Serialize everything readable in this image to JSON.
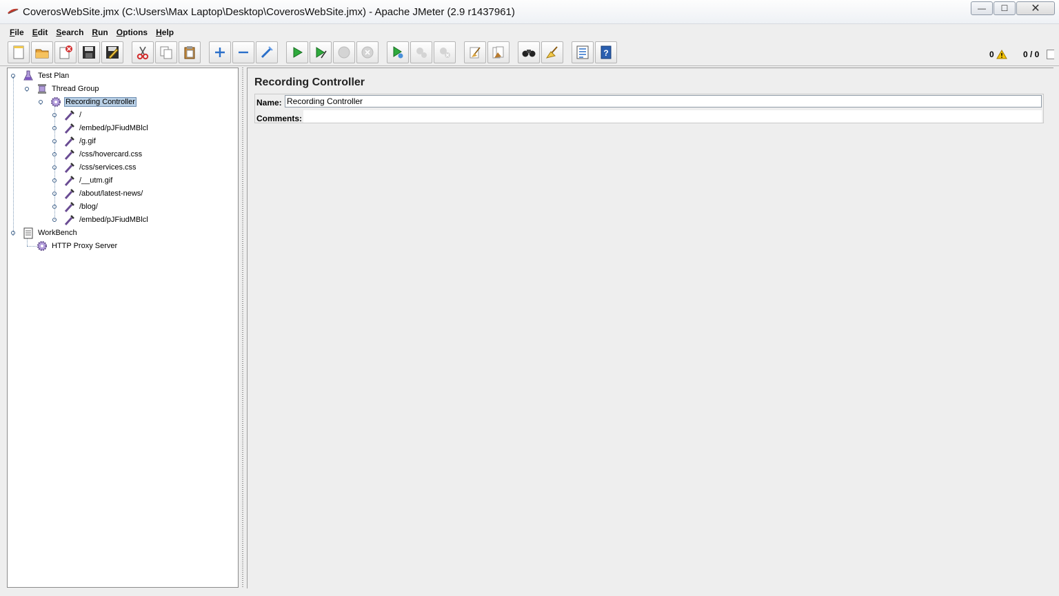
{
  "window": {
    "title": "CoverosWebSite.jmx (C:\\Users\\Max Laptop\\Desktop\\CoverosWebSite.jmx) - Apache JMeter (2.9 r1437961)",
    "controls": {
      "minimize": "—",
      "maximize": "☐",
      "close": "✕"
    }
  },
  "menu": [
    {
      "label": "File",
      "mnemonic": "F",
      "rest": "ile"
    },
    {
      "label": "Edit",
      "mnemonic": "E",
      "rest": "dit"
    },
    {
      "label": "Search",
      "mnemonic": "S",
      "rest": "earch"
    },
    {
      "label": "Run",
      "mnemonic": "R",
      "rest": "un"
    },
    {
      "label": "Options",
      "mnemonic": "O",
      "rest": "ptions"
    },
    {
      "label": "Help",
      "mnemonic": "H",
      "rest": "elp"
    }
  ],
  "toolbar": {
    "buttons": [
      {
        "name": "new-button",
        "icon": "new-document-icon"
      },
      {
        "name": "open-button",
        "icon": "open-folder-icon"
      },
      {
        "name": "close-button",
        "icon": "close-document-icon"
      },
      {
        "name": "save-button",
        "icon": "floppy-save-icon"
      },
      {
        "name": "save-as-button",
        "icon": "save-edit-icon"
      },
      {
        "name": "cut-button",
        "icon": "scissors-icon"
      },
      {
        "name": "copy-button",
        "icon": "copy-icon"
      },
      {
        "name": "paste-button",
        "icon": "clipboard-paste-icon"
      },
      {
        "name": "expand-all-button",
        "icon": "plus-icon"
      },
      {
        "name": "collapse-all-button",
        "icon": "minus-icon"
      },
      {
        "name": "toggle-button",
        "icon": "wand-toggle-icon"
      },
      {
        "name": "start-button",
        "icon": "play-icon"
      },
      {
        "name": "start-no-pauses-button",
        "icon": "play-no-pause-icon"
      },
      {
        "name": "stop-button",
        "icon": "stop-icon"
      },
      {
        "name": "shutdown-button",
        "icon": "shutdown-icon"
      },
      {
        "name": "remote-start-all-button",
        "icon": "remote-play-icon"
      },
      {
        "name": "remote-stop-all-button",
        "icon": "remote-stop-icon"
      },
      {
        "name": "remote-shutdown-all-button",
        "icon": "remote-shutdown-icon"
      },
      {
        "name": "clear-button",
        "icon": "broom-clear-icon"
      },
      {
        "name": "clear-all-button",
        "icon": "broom-clear-all-icon"
      },
      {
        "name": "search-button",
        "icon": "binoculars-icon"
      },
      {
        "name": "reset-search-button",
        "icon": "broom-reset-icon"
      },
      {
        "name": "function-helper-button",
        "icon": "function-list-icon"
      },
      {
        "name": "help-button",
        "icon": "help-book-icon"
      }
    ],
    "error_count": "0",
    "thread_count": "0 / 0"
  },
  "tree": {
    "nodes": [
      {
        "label": "Test Plan",
        "icon": "flask-icon"
      },
      {
        "label": "Thread Group",
        "icon": "spool-icon"
      },
      {
        "label": "Recording Controller",
        "icon": "gear-icon",
        "selected": true
      },
      {
        "label": "/",
        "icon": "pipette-sampler-icon"
      },
      {
        "label": "/embed/pJFiudMBlcl",
        "icon": "pipette-sampler-icon"
      },
      {
        "label": "/g.gif",
        "icon": "pipette-sampler-icon"
      },
      {
        "label": "/css/hovercard.css",
        "icon": "pipette-sampler-icon"
      },
      {
        "label": "/css/services.css",
        "icon": "pipette-sampler-icon"
      },
      {
        "label": "/__utm.gif",
        "icon": "pipette-sampler-icon"
      },
      {
        "label": "/about/latest-news/",
        "icon": "pipette-sampler-icon"
      },
      {
        "label": "/blog/",
        "icon": "pipette-sampler-icon"
      },
      {
        "label": "/embed/pJFiudMBlcl",
        "icon": "pipette-sampler-icon"
      },
      {
        "label": "WorkBench",
        "icon": "notepad-icon"
      },
      {
        "label": "HTTP Proxy Server",
        "icon": "gear-icon"
      }
    ]
  },
  "detail": {
    "title": "Recording Controller",
    "name_label": "Name:",
    "name_value": "Recording Controller",
    "comments_label": "Comments:",
    "comments_value": ""
  }
}
